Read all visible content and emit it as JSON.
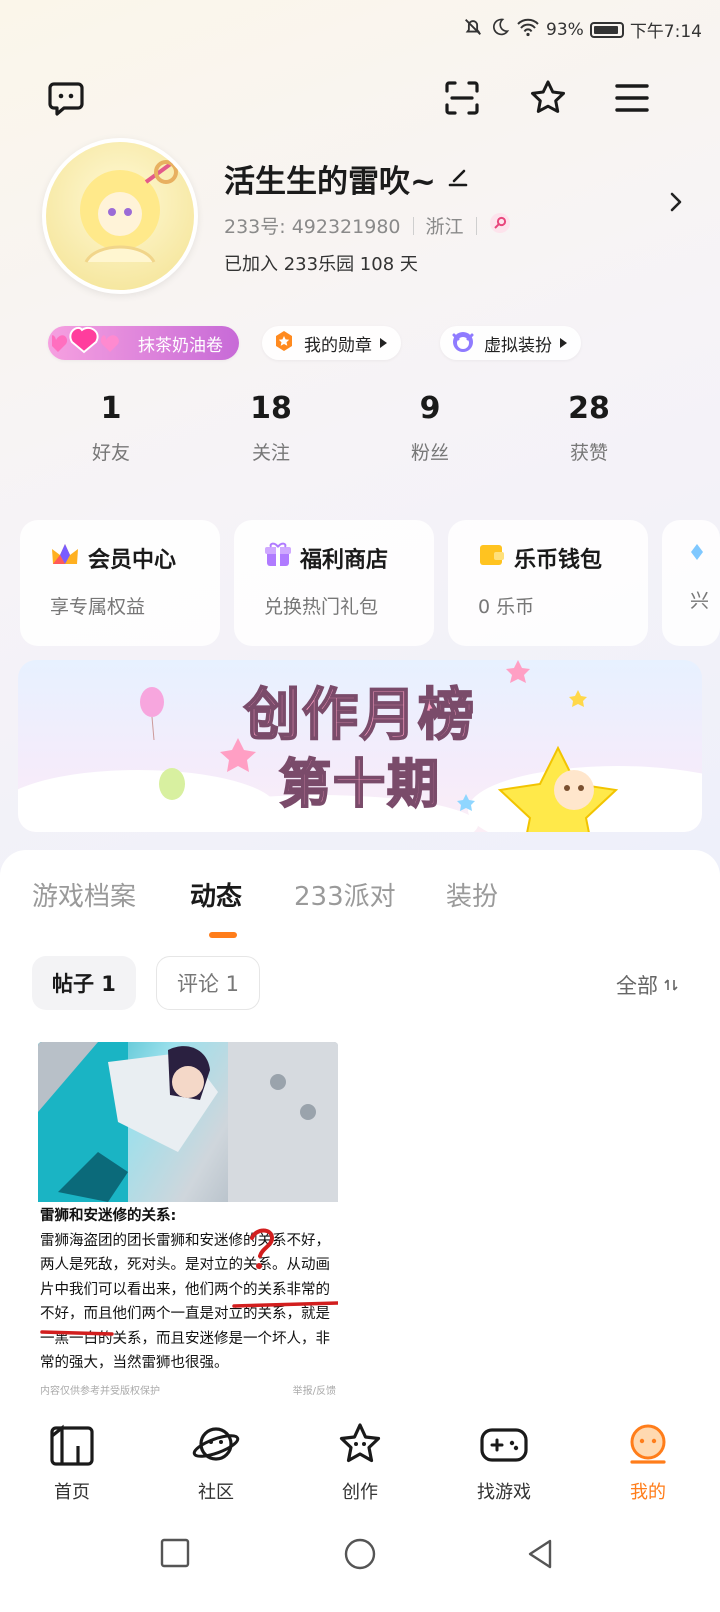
{
  "status_bar": {
    "battery": "93%",
    "time": "下午7:14"
  },
  "profile": {
    "name": "活生生的雷吹~",
    "id_label": "233号: 492321980",
    "location": "浙江",
    "joined": "已加入 233乐园 108 天"
  },
  "badges": [
    {
      "label": "抹茶奶油卷"
    },
    {
      "label": "我的勋章"
    },
    {
      "label": "虚拟装扮"
    }
  ],
  "stats": [
    {
      "value": "1",
      "label": "好友"
    },
    {
      "value": "18",
      "label": "关注"
    },
    {
      "value": "9",
      "label": "粉丝"
    },
    {
      "value": "28",
      "label": "获赞"
    }
  ],
  "cards": [
    {
      "title": "会员中心",
      "subtitle": "享专属权益"
    },
    {
      "title": "福利商店",
      "subtitle": "兑换热门礼包"
    },
    {
      "title": "乐币钱包",
      "subtitle": "0 乐币"
    },
    {
      "title": "",
      "subtitle": "兴"
    }
  ],
  "banner": {
    "line1": "创作月榜",
    "line2": "第十期"
  },
  "tabs": [
    {
      "label": "游戏档案"
    },
    {
      "label": "动态"
    },
    {
      "label": "233派对"
    },
    {
      "label": "装扮"
    }
  ],
  "filters": {
    "posts": "帖子 1",
    "comments": "评论 1",
    "all": "全部"
  },
  "post": {
    "title": "雷狮和安迷修的关系:",
    "body": "雷狮海盗团的团长雷狮和安迷修的关系不好，两人是死敌，死对头。是对立的关系。从动画片中我们可以看出来，他们两个的关系非常的不好，而且他们两个一直是对立的关系，就是一黑一白的关系，而且安迷修是一个坏人，非常的强大，当然雷狮也很强。",
    "footer_left": "内容仅供参考并受版权保护",
    "footer_right": "举报/反馈"
  },
  "nav": [
    {
      "label": "首页"
    },
    {
      "label": "社区"
    },
    {
      "label": "创作"
    },
    {
      "label": "找游戏"
    },
    {
      "label": "我的"
    }
  ],
  "colors": {
    "accent": "#ff7d1a",
    "badge_pink": "#d35fc8"
  }
}
